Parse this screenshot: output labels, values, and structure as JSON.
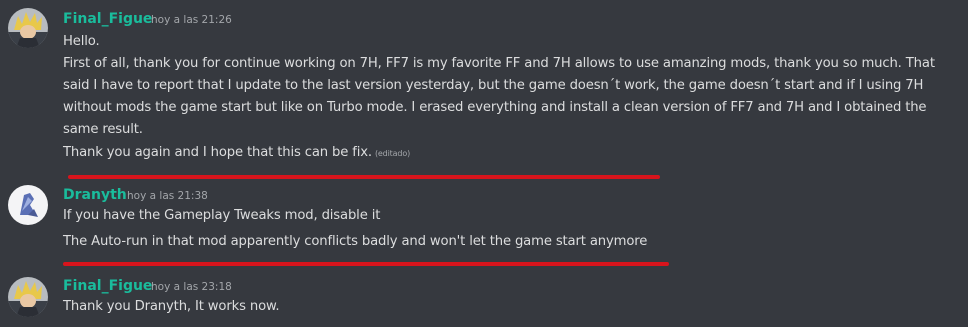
{
  "messages": [
    {
      "username": "Final_Figue",
      "username_color": "#1abc9c",
      "timestamp": "hoy a las 21:26",
      "lines": [
        "Hello.",
        "First of all, thank you for continue working on 7H, FF7 is my favorite FF and 7H allows to use amanzing mods, thank you so much. That",
        "said I have to report that I update to the last version yesterday, but the game doesn´t work, the game doesn´t start and if I using 7H",
        "without mods the game start but like on Turbo mode. I erased everything and install a clean version of FF7 and 7H and I obtained the",
        "same result.",
        "Thank you again and I hope that this can be fix."
      ],
      "edited_label": "(editado)"
    },
    {
      "username": "Dranyth",
      "username_color": "#1abc9c",
      "timestamp": "hoy a las 21:38",
      "lines": [
        "If you have the Gameplay Tweaks mod, disable it",
        "The Auto-run in that mod apparently conflicts badly and won't let the game start anymore"
      ]
    },
    {
      "username": "Final_Figue",
      "username_color": "#1abc9c",
      "timestamp": "hoy a las 23:18",
      "lines": [
        "Thank you Dranyth, It works now."
      ]
    }
  ],
  "colors": {
    "background": "#36393f",
    "text": "#dcddde",
    "muted": "#a3a6aa",
    "highlight_underline": "#d8141c"
  }
}
